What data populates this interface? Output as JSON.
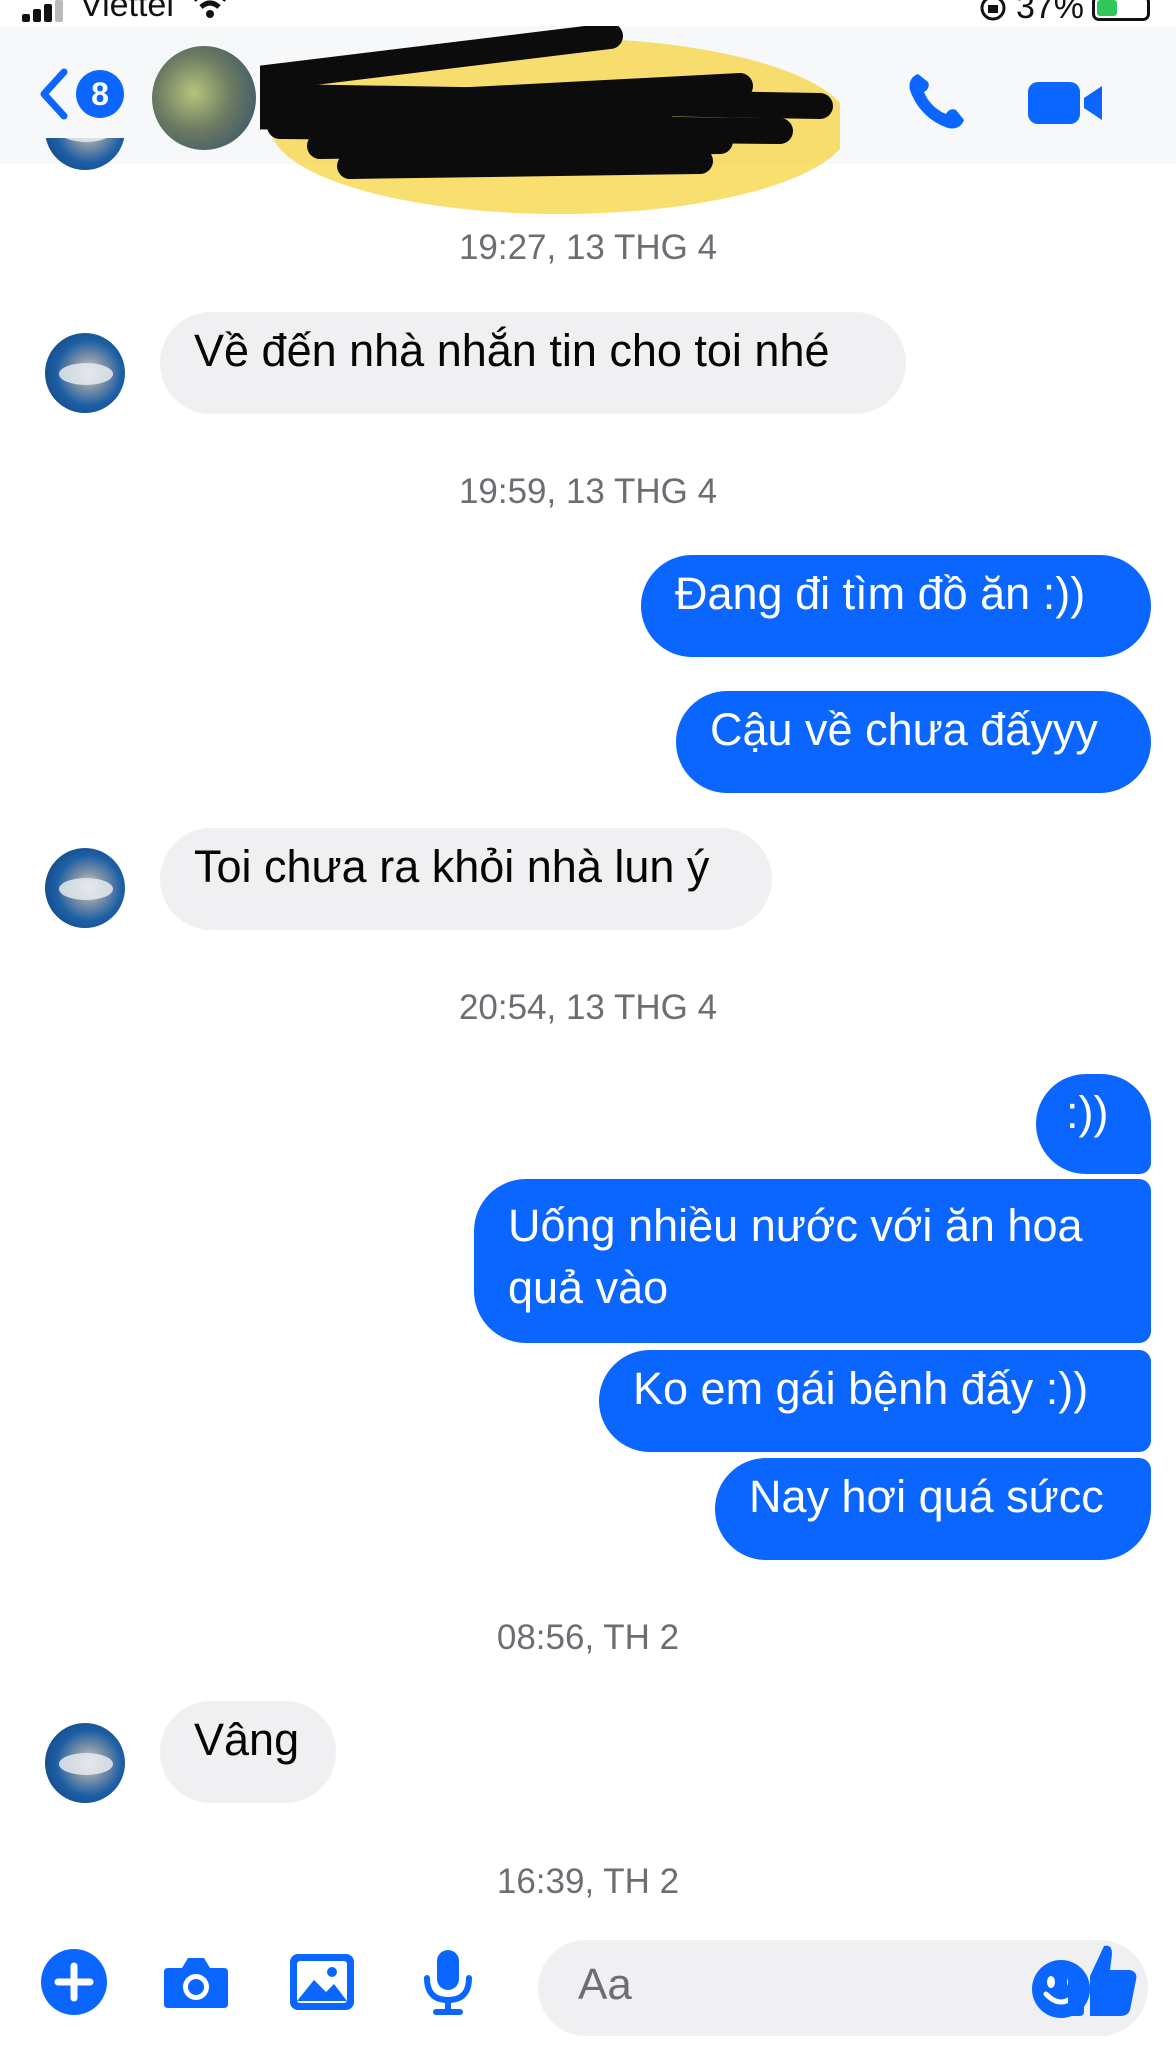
{
  "status_bar": {
    "carrier": "Viettel",
    "battery": "37%"
  },
  "header": {
    "unread_count": "8"
  },
  "messages": [
    {
      "type": "time",
      "text": "19:27, 13 THG 4"
    },
    {
      "type": "in",
      "text": "Về đến nhà nhắn tin cho toi nhé"
    },
    {
      "type": "time",
      "text": "19:59, 13 THG 4"
    },
    {
      "type": "out",
      "text": "Đang đi tìm đồ ăn :))"
    },
    {
      "type": "out",
      "text": "Cậu về chưa đấyyy"
    },
    {
      "type": "in",
      "text": "Toi chưa ra khỏi nhà lun ý"
    },
    {
      "type": "time",
      "text": "20:54, 13 THG 4"
    },
    {
      "type": "out",
      "text": ":))"
    },
    {
      "type": "out",
      "text": "Uống nhiều nước với ăn hoa quả vào"
    },
    {
      "type": "out",
      "text": "Ko em gái bệnh đấy :))"
    },
    {
      "type": "out",
      "text": "Nay hơi quá sứcc"
    },
    {
      "type": "time",
      "text": "08:56, TH 2"
    },
    {
      "type": "in",
      "text": "Vâng"
    },
    {
      "type": "time",
      "text": "16:39, TH 2"
    }
  ],
  "composer": {
    "placeholder": "Aa"
  },
  "icons": {
    "back": "chevron-left-icon",
    "call": "phone-icon",
    "video": "video-camera-icon",
    "add": "plus-circle-icon",
    "camera": "camera-icon",
    "gallery": "image-icon",
    "mic": "microphone-icon",
    "emoji": "smiley-icon",
    "like": "thumbs-up-icon"
  },
  "colors": {
    "accent": "#0a66ff",
    "incoming_bubble": "#f0f0f2",
    "timestamp": "#6b6e73"
  }
}
